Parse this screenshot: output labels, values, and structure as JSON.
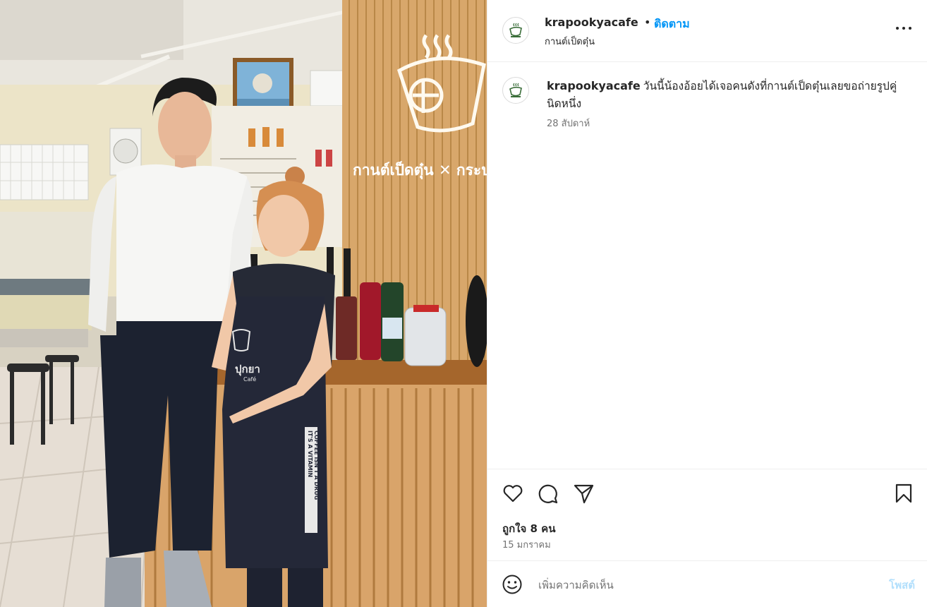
{
  "post": {
    "username": "krapookyacafe",
    "follow_label": "ติดตาม",
    "location": "กานต์เป็ดตุ๋น",
    "caption_text": "วันนี้น้องอ้อยได้เจอคนดังที่กานต์เป็ดตุ๋นเลยขอถ่ายรูปคู่นิดหนึ่ง",
    "caption_time": "28 สัปดาห์",
    "likes": "ถูกใจ 8 คน",
    "date": "15 มกราคม"
  },
  "photo": {
    "wall_sign": "กานต์เป็ดตุ๋น ✕ กระปุก",
    "apron_brand": "ปุกยา",
    "apron_sub": "Café",
    "apron_strap_line1": "COFFEE ISN'T A DRUG",
    "apron_strap_line2": "IT'S A VITAMIN"
  },
  "comment": {
    "placeholder": "เพิ่มความคิดเห็น",
    "post_label": "โพสต์"
  },
  "icons": [
    "more-options-icon",
    "heart-icon",
    "comment-icon",
    "share-icon",
    "bookmark-icon",
    "emoji-icon"
  ],
  "colors": {
    "accent": "#0095f6",
    "post_disabled": "#b2dffc",
    "muted": "#737373"
  }
}
